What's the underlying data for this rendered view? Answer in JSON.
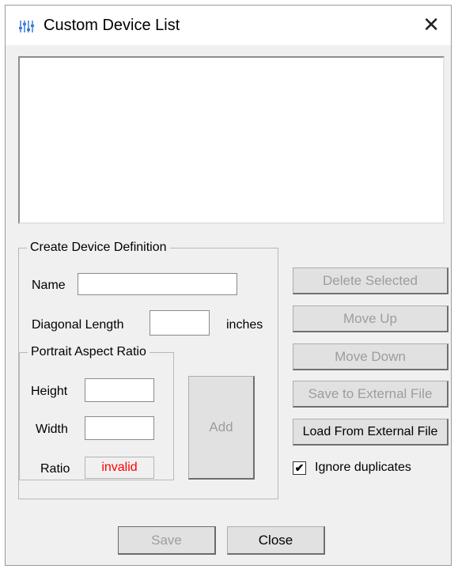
{
  "window": {
    "title": "Custom Device List",
    "close_glyph": "✕",
    "app_icon": "sliders-icon"
  },
  "device_list": {
    "items": []
  },
  "create_group": {
    "label": "Create Device Definition",
    "name_label": "Name",
    "name_value": "",
    "diagonal_label": "Diagonal Length",
    "diagonal_value": "",
    "inches_label": "inches"
  },
  "aspect_group": {
    "label": "Portrait Aspect Ratio",
    "height_label": "Height",
    "height_value": "",
    "width_label": "Width",
    "width_value": "",
    "ratio_label": "Ratio",
    "ratio_value": "invalid",
    "ratio_color": "#ff0000"
  },
  "buttons": {
    "add": "Add",
    "delete_selected": "Delete Selected",
    "move_up": "Move Up",
    "move_down": "Move Down",
    "save_external": "Save to External File",
    "load_external": "Load From External File",
    "save": "Save",
    "close": "Close"
  },
  "ignore_duplicates": {
    "label": "Ignore duplicates",
    "checked": true,
    "mark": "✔"
  },
  "colors": {
    "disabled_text": "#9d9d9d",
    "invalid_text": "#ff0000"
  }
}
